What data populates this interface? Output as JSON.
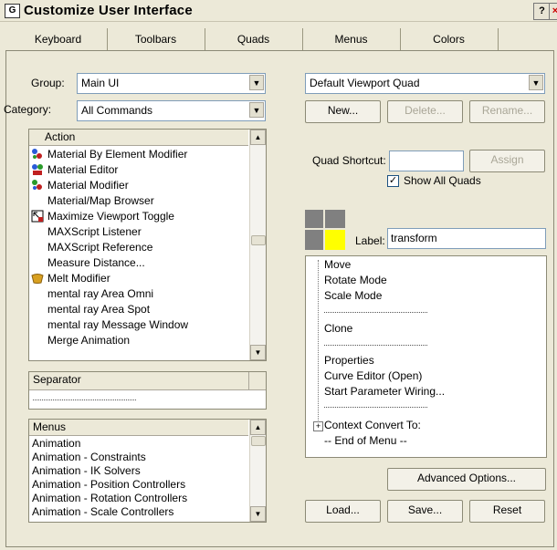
{
  "window": {
    "title": "Customize User Interface",
    "help_btn": "?",
    "close_btn": "×"
  },
  "tabs": [
    "Keyboard",
    "Toolbars",
    "Quads",
    "Menus",
    "Colors"
  ],
  "left": {
    "group_label": "Group:",
    "group_value": "Main UI",
    "category_label": "Category:",
    "category_value": "All Commands",
    "action_header": "Action",
    "actions": [
      "Material By Element Modifier",
      "Material Editor",
      "Material Modifier",
      "Material/Map Browser",
      "Maximize Viewport Toggle",
      "MAXScript Listener",
      "MAXScript Reference",
      "Measure Distance...",
      "Melt Modifier",
      "mental ray Area Omni",
      "mental ray Area Spot",
      "mental ray Message Window",
      "Merge Animation"
    ],
    "separator_header": "Separator",
    "menus_header": "Menus",
    "menus": [
      "Animation",
      "Animation - Constraints",
      "Animation - IK Solvers",
      "Animation - Position Controllers",
      "Animation - Rotation Controllers",
      "Animation - Scale Controllers"
    ]
  },
  "right": {
    "quad_combo_value": "Default Viewport Quad",
    "new_btn": "New...",
    "delete_btn": "Delete...",
    "rename_btn": "Rename...",
    "shortcut_label": "Quad Shortcut:",
    "shortcut_value": "",
    "assign_btn": "Assign",
    "show_all_label": "Show All Quads",
    "show_all_checked": "✓",
    "label_label": "Label:",
    "label_value": "transform",
    "quad_items": [
      {
        "type": "item",
        "text": "Move"
      },
      {
        "type": "item",
        "text": "Rotate Mode"
      },
      {
        "type": "item",
        "text": "Scale Mode"
      },
      {
        "type": "sep",
        "text": ""
      },
      {
        "type": "item",
        "text": "Clone"
      },
      {
        "type": "sep",
        "text": ""
      },
      {
        "type": "item",
        "text": "Properties"
      },
      {
        "type": "item",
        "text": "Curve Editor (Open)"
      },
      {
        "type": "item",
        "text": "Start Parameter Wiring..."
      },
      {
        "type": "sep",
        "text": ""
      },
      {
        "type": "sub",
        "text": "Context Convert To:"
      },
      {
        "type": "item",
        "text": "-- End of Menu --"
      }
    ],
    "advanced_btn": "Advanced Options...",
    "load_btn": "Load...",
    "save_btn": "Save...",
    "reset_btn": "Reset"
  },
  "colors": {
    "quad_selected": "#ffff00",
    "quad_default": "#808080"
  }
}
